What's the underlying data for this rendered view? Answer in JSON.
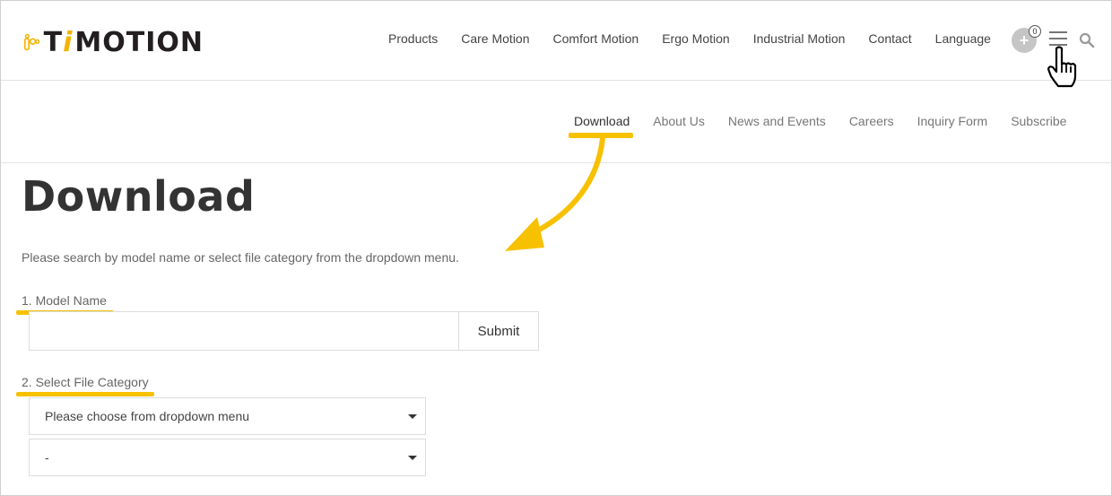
{
  "brand": {
    "name": "TiMOTION",
    "name_t": "T",
    "name_i": "i",
    "name_rest": "MOTION",
    "accent_color": "#f5b200"
  },
  "main_nav": [
    "Products",
    "Care Motion",
    "Comfort Motion",
    "Ergo Motion",
    "Industrial Motion",
    "Contact",
    "Language"
  ],
  "header_icons": {
    "cart_icon": "plus-circle-icon",
    "cart_count": "0",
    "menu_icon": "hamburger-icon",
    "search_icon": "search-icon",
    "cursor": "hand-pointer-icon"
  },
  "sub_nav": [
    "Download",
    "About Us",
    "News and Events",
    "Careers",
    "Inquiry Form",
    "Subscribe"
  ],
  "sub_nav_active": "Download",
  "page": {
    "title": "Download",
    "intro": "Please search by model name or select file category from the dropdown menu.",
    "model_label": "1. Model Name",
    "model_value": "",
    "submit_label": "Submit",
    "category_label": "2. Select File Category",
    "category_select": "Please choose from dropdown menu",
    "subcategory_select": "-"
  },
  "highlight_color": "#f7c100"
}
